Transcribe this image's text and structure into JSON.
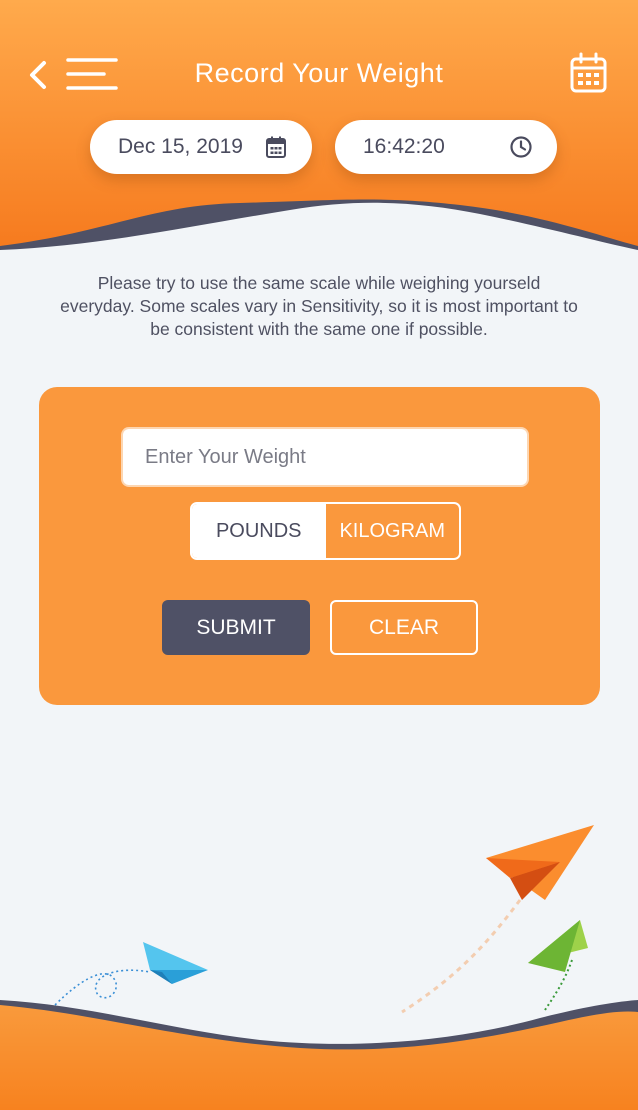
{
  "header": {
    "title": "Record Your Weight",
    "date": "Dec 15, 2019",
    "time": "16:42:20"
  },
  "info_text": "Please try to use the same scale while weighing yourseld everyday. Some scales vary in Sensitivity, so it is most important to be consistent with the same one if possible.",
  "form": {
    "weight_placeholder": "Enter Your Weight",
    "unit_options": [
      "POUNDS",
      "KILOGRAM"
    ],
    "selected_unit": "POUNDS",
    "submit_label": "SUBMIT",
    "clear_label": "CLEAR"
  },
  "icons": [
    "back-arrow-icon",
    "hamburger-menu-icon",
    "calendar-icon",
    "clock-icon",
    "paper-plane-icon"
  ],
  "colors": {
    "orange": "#f67f20",
    "card_orange": "#fa983d",
    "dark": "#4f5166",
    "background": "#f2f5f8"
  }
}
